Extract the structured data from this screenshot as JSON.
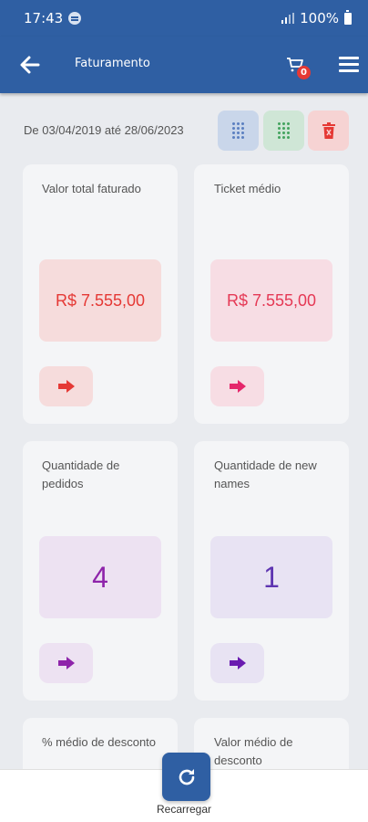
{
  "status_bar": {
    "time": "17:43",
    "battery": "100%"
  },
  "app_bar": {
    "title": "Faturamento",
    "cart_count": "0"
  },
  "filter": {
    "date_range": "De 03/04/2019 até 28/06/2023"
  },
  "cards": [
    {
      "label": "Valor total faturado",
      "value": "R$ 7.555,00",
      "color": "#e53935"
    },
    {
      "label": "Ticket médio",
      "value": "R$ 7.555,00",
      "color": "#e53935"
    },
    {
      "label": "Quantidade de pedidos",
      "value": "4",
      "color": "#8e24aa"
    },
    {
      "label": "Quantidade de new names",
      "value": "1",
      "color": "#5e35b1"
    },
    {
      "label": "% médio de desconto"
    },
    {
      "label": "Valor médio de desconto"
    }
  ],
  "bottom": {
    "reload_label": "Recarregar"
  },
  "colors": {
    "primary": "#2f5fa3",
    "red": "#e53935",
    "purple": "#8e24aa",
    "deep_purple": "#5e35b1"
  }
}
